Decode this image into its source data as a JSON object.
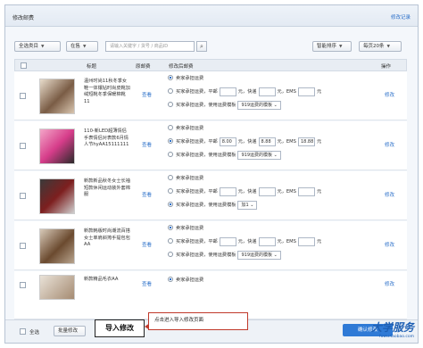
{
  "header": {
    "title": "修改邮费",
    "link": "修改记录"
  },
  "toolbar": {
    "category": "全选类目",
    "status": "在售",
    "search_placeholder": "请输入关键字 / 货号 / 商品ID",
    "sort": "智能排序",
    "page_size": "每页20条"
  },
  "table": {
    "col_title": "标题",
    "col_original": "原邮费",
    "col_new": "修改后邮费",
    "col_action": "操作"
  },
  "rows": [
    {
      "title": "温州时尚11秋冬季女鞋一体镶钻时尚皮靴加绒短靴冬季保暖棉靴11",
      "view": "查看",
      "opt1": "卖家承担运费",
      "opt2_prefix": "买家承担运费，平邮",
      "opt2_ping": "",
      "opt2_kd": "快递",
      "opt2_kd_val": "",
      "opt2_ems": "EMS",
      "opt2_ems_val": "",
      "opt2_unit": "元",
      "opt3": "买家承担运费，使用运费模板",
      "opt3_sel": "919运费的模板",
      "selected": 1,
      "edit": "修改"
    },
    {
      "title": "110-新LED超薄情侣手表情侣对表款6月情人节hyAA15111111",
      "view": "查看",
      "opt1": "卖家承担运费",
      "opt2_prefix": "买家承担运费，平邮",
      "opt2_ping": "8.00",
      "opt2_kd": "快递",
      "opt2_kd_val": "8.88",
      "opt2_ems": "EMS",
      "opt2_ems_val": "18.88",
      "opt2_unit": "元",
      "opt3": "买家承担运费，使用运费模板",
      "opt3_sel": "919运费的模板",
      "selected": 2,
      "edit": "修改"
    },
    {
      "title": "新款新品秋冬女士长袖短款休闲运动装外套棉服",
      "view": "查看",
      "opt1": "卖家承担运费",
      "opt2_prefix": "买家承担运费，平邮",
      "opt2_ping": "",
      "opt2_kd": "快递",
      "opt2_kd_val": "",
      "opt2_ems": "EMS",
      "opt2_ems_val": "",
      "opt2_unit": "元",
      "opt3": "买家承担运费，使用运费模板",
      "opt3_sel": "加1",
      "selected": 3,
      "edit": "修改"
    },
    {
      "title": "新款韩版时尚潮流百搭女士单肩斜挎手提包包AA",
      "view": "查看",
      "opt1": "卖家承担运费",
      "opt2_prefix": "买家承担运费，平邮",
      "opt2_ping": "",
      "opt2_kd": "快递",
      "opt2_kd_val": "",
      "opt2_ems": "EMS",
      "opt2_ems_val": "",
      "opt2_unit": "元",
      "opt3": "买家承担运费，使用运费模板",
      "opt3_sel": "919运费的模板",
      "selected": 1,
      "edit": "修改"
    },
    {
      "title": "新款精品毛衣AA",
      "view": "查看",
      "opt1": "卖家承担运费",
      "opt2_prefix": "",
      "opt2_ping": "",
      "opt2_kd": "",
      "opt2_kd_val": "",
      "opt2_ems": "",
      "opt2_ems_val": "",
      "opt2_unit": "",
      "opt3": "",
      "opt3_sel": "",
      "selected": 1,
      "edit": "修改"
    }
  ],
  "footer": {
    "select_all": "全选",
    "batch_edit": "批量修改",
    "import_edit": "导入修改",
    "callout": "点击进入导入修改页面",
    "confirm": "确认修改"
  },
  "watermark": {
    "big": "大学服务",
    "small": "fuwu.taobao.com"
  },
  "colors": {
    "accent": "#2f7ad6",
    "link": "#2a6fc9",
    "callout_border": "#c0392b"
  }
}
